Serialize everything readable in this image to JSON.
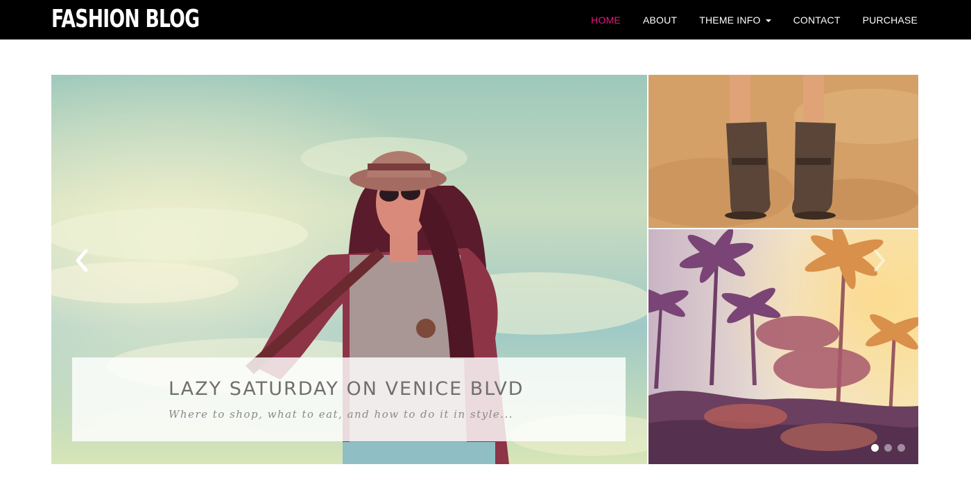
{
  "header": {
    "logo": "FASHION BLOG",
    "nav": [
      {
        "label": "HOME",
        "active": true
      },
      {
        "label": "ABOUT",
        "active": false
      },
      {
        "label": "THEME INFO",
        "active": false,
        "has_dropdown": true
      },
      {
        "label": "CONTACT",
        "active": false
      },
      {
        "label": "PURCHASE",
        "active": false
      }
    ]
  },
  "slider": {
    "caption": {
      "title": "LAZY SATURDAY ON VENICE BLVD",
      "subtitle": "Where to shop, what to eat, and how to do it in style..."
    },
    "prev_icon": "chevron-left-icon",
    "next_icon": "chevron-right-icon",
    "slide_count": 3,
    "active_slide": 1
  },
  "colors": {
    "header_bg": "#000000",
    "nav_text": "#ffffff",
    "nav_active": "#e6177f",
    "caption_title": "#6f6f6f",
    "caption_subtitle": "#8a8a8a"
  }
}
